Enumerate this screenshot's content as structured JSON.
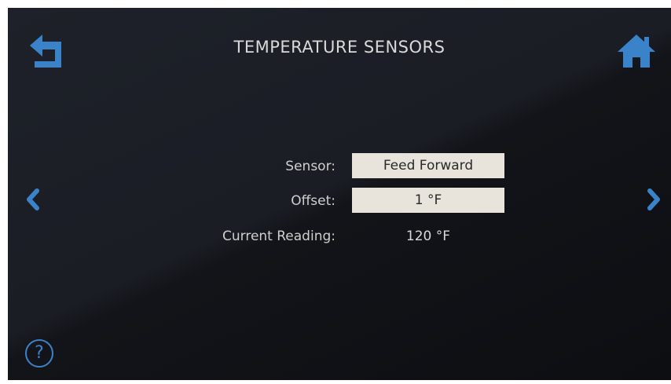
{
  "header": {
    "title": "TEMPERATURE SENSORS"
  },
  "icons": {
    "back": "back-arrow-icon",
    "home": "home-icon",
    "prev": "chevron-left-icon",
    "next": "chevron-right-icon",
    "help": "help-icon"
  },
  "help": {
    "glyph": "?"
  },
  "form": {
    "sensor_label": "Sensor:",
    "sensor_value": "Feed Forward",
    "offset_label": "Offset:",
    "offset_value": "1 °F",
    "reading_label": "Current Reading:",
    "reading_value": "120 °F"
  },
  "colors": {
    "accent": "#3b83c9",
    "field_bg": "#e8e3db",
    "background": "#15171c",
    "text": "#d9d9d9"
  }
}
